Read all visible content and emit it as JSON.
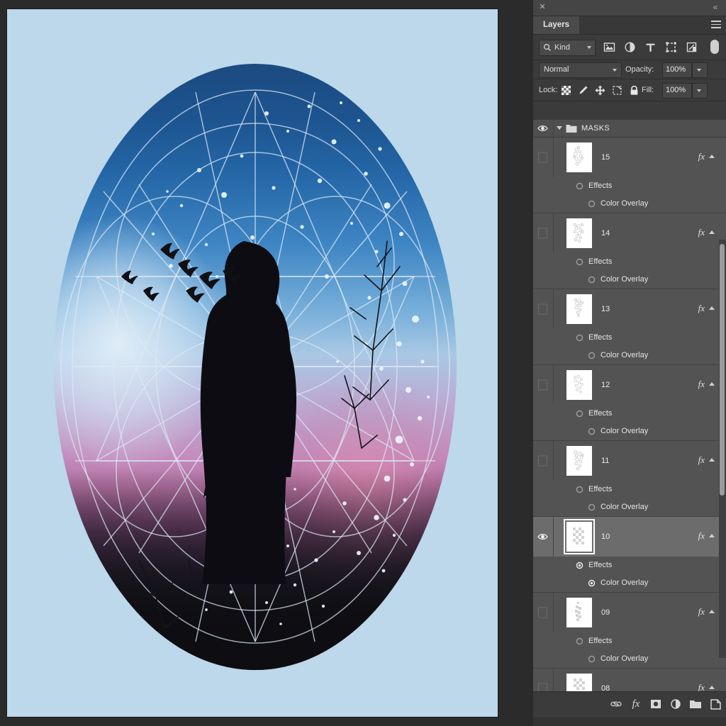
{
  "app": {
    "panel_title": "Layers",
    "close_icon": "close-icon",
    "collapse_icon": "double-chevron-left-icon",
    "menu_icon": "hamburger-menu-icon"
  },
  "filter": {
    "kind_label": "Kind",
    "search_icon": "search-icon",
    "icons": [
      {
        "name": "filter-pixel-layers-icon"
      },
      {
        "name": "filter-adjustment-layers-icon"
      },
      {
        "name": "filter-type-layers-icon"
      },
      {
        "name": "filter-shape-layers-icon"
      },
      {
        "name": "filter-smart-object-layers-icon"
      }
    ],
    "toggle_icon": "filter-enable-toggle"
  },
  "blend": {
    "mode": "Normal",
    "opacity_label": "Opacity:",
    "opacity_value": "100%"
  },
  "lock": {
    "label": "Lock:",
    "fill_label": "Fill:",
    "fill_value": "100%",
    "icons": [
      {
        "name": "lock-transparent-pixels-icon"
      },
      {
        "name": "lock-image-pixels-icon"
      },
      {
        "name": "lock-position-icon"
      },
      {
        "name": "lock-artboard-nesting-icon"
      },
      {
        "name": "lock-all-icon"
      }
    ]
  },
  "group": {
    "name": "MASKS",
    "visible": true,
    "expanded": true
  },
  "effects_label": "Effects",
  "color_overlay_label": "Color Overlay",
  "layers": [
    {
      "name": "15",
      "visible": false,
      "selected": false,
      "has_fx": true
    },
    {
      "name": "14",
      "visible": false,
      "selected": false,
      "has_fx": true
    },
    {
      "name": "13",
      "visible": false,
      "selected": false,
      "has_fx": true
    },
    {
      "name": "12",
      "visible": false,
      "selected": false,
      "has_fx": true
    },
    {
      "name": "11",
      "visible": false,
      "selected": false,
      "has_fx": true
    },
    {
      "name": "10",
      "visible": true,
      "selected": true,
      "has_fx": true
    },
    {
      "name": "09",
      "visible": false,
      "selected": false,
      "has_fx": true
    },
    {
      "name": "08",
      "visible": false,
      "selected": false,
      "has_fx": true
    }
  ],
  "bottom_toolbar": [
    {
      "name": "link-layers-icon"
    },
    {
      "name": "add-layer-style-fx-icon"
    },
    {
      "name": "add-layer-mask-icon"
    },
    {
      "name": "new-adjustment-layer-icon"
    },
    {
      "name": "new-group-icon"
    },
    {
      "name": "new-layer-icon"
    },
    {
      "name": "delete-layer-icon"
    }
  ],
  "canvas": {
    "background_color": "#bcd8ea",
    "artwork_title": "silhouette-in-sacred-geometry-oval"
  },
  "colors": {
    "panel_bg": "#3b3b3b",
    "list_bg": "#535353",
    "selected_row": "#6c6c6c",
    "canvas_bg": "#bcd8ea",
    "workspace_bg": "#2b2b2b"
  }
}
